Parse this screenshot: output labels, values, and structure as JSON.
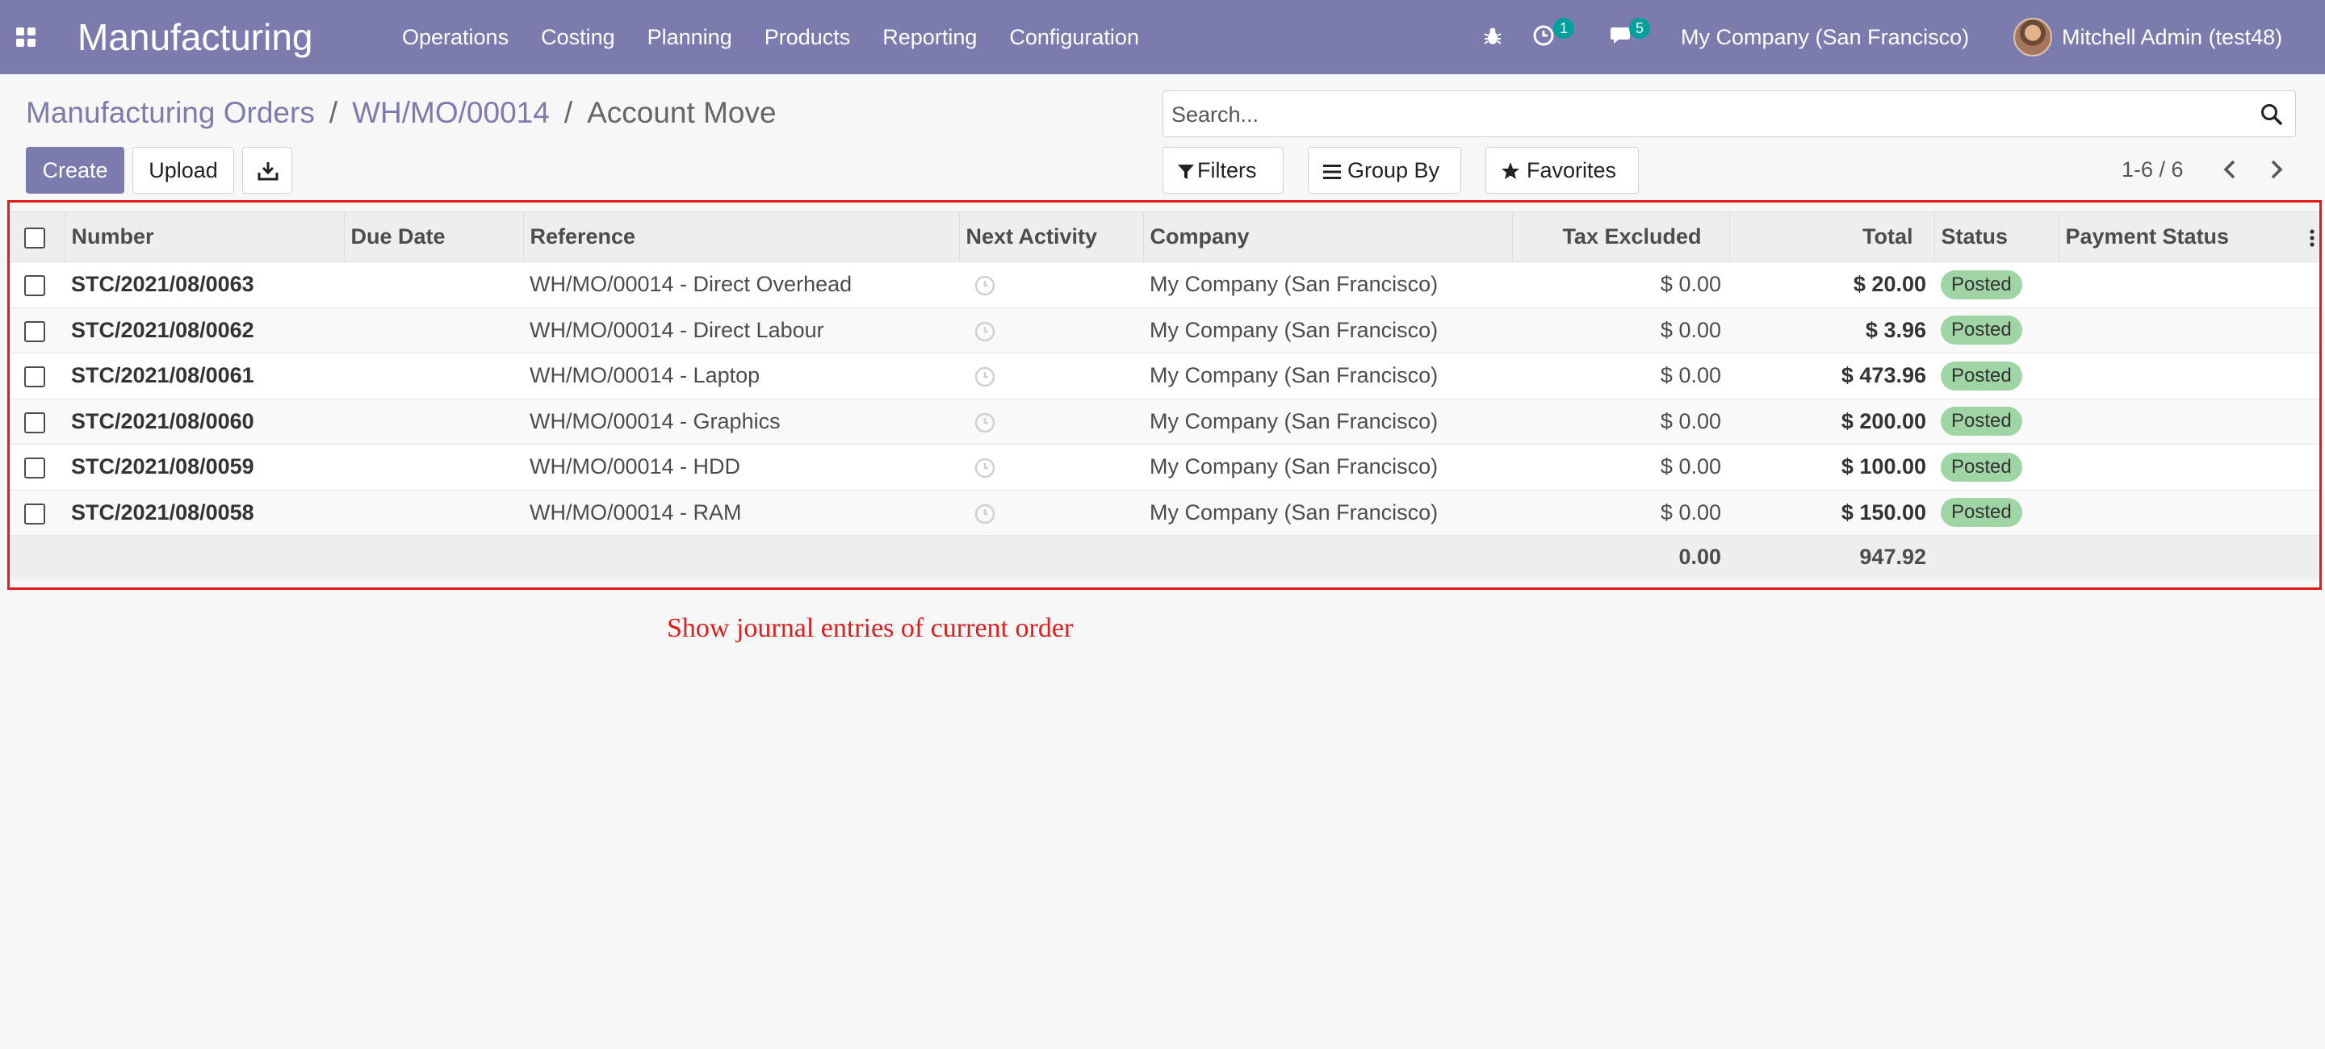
{
  "navbar": {
    "app_title": "Manufacturing",
    "menu": [
      "Operations",
      "Costing",
      "Planning",
      "Products",
      "Reporting",
      "Configuration"
    ],
    "activity_badge": "1",
    "messages_badge": "5",
    "company": "My Company (San Francisco)",
    "user": "Mitchell Admin (test48)",
    "color": "#7c7bad"
  },
  "breadcrumb": {
    "items": [
      "Manufacturing Orders",
      "WH/MO/00014"
    ],
    "current": "Account Move",
    "separator": "/"
  },
  "toolbar": {
    "create_label": "Create",
    "upload_label": "Upload",
    "download_icon": "download-icon"
  },
  "search": {
    "placeholder": "Search...",
    "filters_label": "Filters",
    "group_by_label": "Group By",
    "favorites_label": "Favorites"
  },
  "pager": {
    "value": "1-6 / 6"
  },
  "table": {
    "columns": [
      "Number",
      "Due Date",
      "Reference",
      "Next Activity",
      "Company",
      "Tax Excluded",
      "Total",
      "Status",
      "Payment Status"
    ],
    "rows": [
      {
        "number": "STC/2021/08/0063",
        "due_date": "",
        "reference": "WH/MO/00014 - Direct Overhead",
        "company": "My Company (San Francisco)",
        "tax_excluded": "$ 0.00",
        "total": "$ 20.00",
        "status": "Posted",
        "payment_status": ""
      },
      {
        "number": "STC/2021/08/0062",
        "due_date": "",
        "reference": "WH/MO/00014 - Direct Labour",
        "company": "My Company (San Francisco)",
        "tax_excluded": "$ 0.00",
        "total": "$ 3.96",
        "status": "Posted",
        "payment_status": ""
      },
      {
        "number": "STC/2021/08/0061",
        "due_date": "",
        "reference": "WH/MO/00014 - Laptop",
        "company": "My Company (San Francisco)",
        "tax_excluded": "$ 0.00",
        "total": "$ 473.96",
        "status": "Posted",
        "payment_status": ""
      },
      {
        "number": "STC/2021/08/0060",
        "due_date": "",
        "reference": "WH/MO/00014 - Graphics",
        "company": "My Company (San Francisco)",
        "tax_excluded": "$ 0.00",
        "total": "$ 200.00",
        "status": "Posted",
        "payment_status": ""
      },
      {
        "number": "STC/2021/08/0059",
        "due_date": "",
        "reference": "WH/MO/00014 - HDD",
        "company": "My Company (San Francisco)",
        "tax_excluded": "$ 0.00",
        "total": "$ 100.00",
        "status": "Posted",
        "payment_status": ""
      },
      {
        "number": "STC/2021/08/0058",
        "due_date": "",
        "reference": "WH/MO/00014 - RAM",
        "company": "My Company (San Francisco)",
        "tax_excluded": "$ 0.00",
        "total": "$ 150.00",
        "status": "Posted",
        "payment_status": ""
      }
    ],
    "footer": {
      "tax_excluded_sum": "0.00",
      "total_sum": "947.92"
    }
  },
  "annotation": {
    "text": "Show journal entries of current order",
    "color": "#e21b1b"
  }
}
